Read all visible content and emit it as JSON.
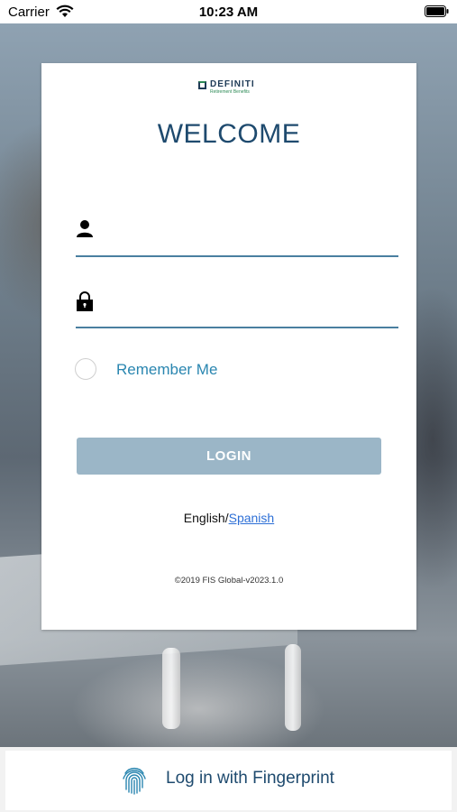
{
  "status_bar": {
    "carrier": "Carrier",
    "time": "10:23 AM"
  },
  "logo": {
    "name": "DEFINITI",
    "tagline": "Retirement Benefits"
  },
  "login": {
    "title": "WELCOME",
    "username": {
      "value": "",
      "placeholder": ""
    },
    "password": {
      "value": "",
      "placeholder": ""
    },
    "remember_label": "Remember Me",
    "login_button": "LOGIN"
  },
  "language": {
    "current": "English",
    "separator": "/",
    "alternate": "Spanish"
  },
  "footer": {
    "copyright": "©2019 FIS Global-v2023.1.0"
  },
  "fingerprint": {
    "label": "Log in with Fingerprint"
  },
  "colors": {
    "brand": "#1e4a6e",
    "accent": "#2a86b0",
    "button_disabled": "#9bb6c7",
    "link": "#2d6fd6"
  }
}
